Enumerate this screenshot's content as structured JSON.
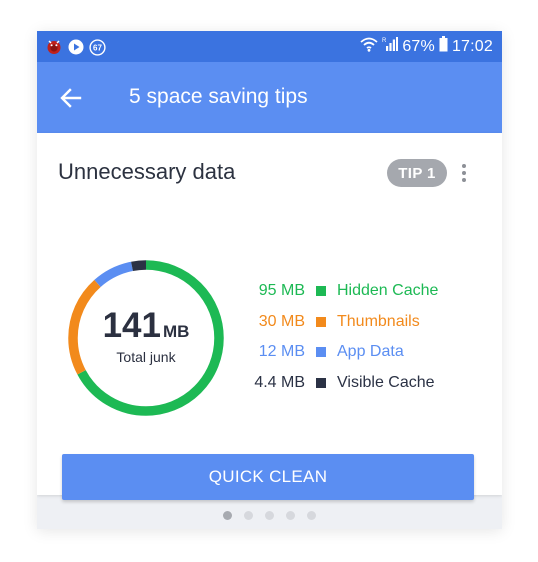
{
  "status_bar": {
    "notification_icons": [
      "bug-icon",
      "play-icon",
      "counter-badge-icon"
    ],
    "notification_badge_number": "67",
    "battery_percent": "67%",
    "time": "17:02",
    "colors": {
      "background": "#3b73e0",
      "text": "#ffffff"
    }
  },
  "app_bar": {
    "back_icon": "arrow-left-icon",
    "title": "5 space saving tips",
    "background": "#5b8ef2"
  },
  "card": {
    "title": "Unnecessary data",
    "tip_badge": "TIP 1",
    "menu_icon": "more-vert-icon",
    "total": {
      "value": "141",
      "unit": "MB",
      "caption": "Total junk"
    },
    "legend": [
      {
        "size": "95 MB",
        "label": "Hidden Cache",
        "color": "#1db954"
      },
      {
        "size": "30 MB",
        "label": "Thumbnails",
        "color": "#f28a1c"
      },
      {
        "size": "12 MB",
        "label": "App Data",
        "color": "#5b8ef2"
      },
      {
        "size": "4.4 MB",
        "label": "Visible Cache",
        "color": "#2b3245"
      }
    ],
    "donut_values_mb": [
      95,
      30,
      12,
      4.4
    ],
    "quick_clean_label": "QUICK CLEAN"
  },
  "pager": {
    "page_count": 5,
    "active_index": 0
  }
}
